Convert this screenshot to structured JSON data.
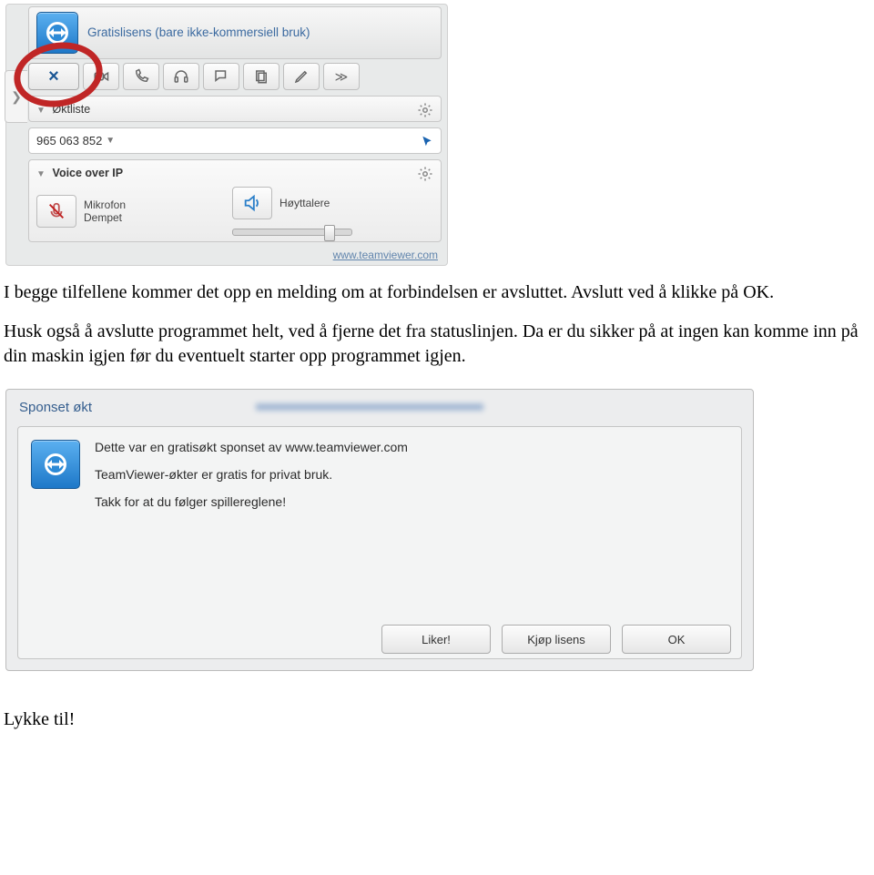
{
  "panel": {
    "header_text": "Gratislisens (bare ikke-kommersiell bruk)",
    "toolbar": {
      "close_label": "×",
      "icons": [
        "video-icon",
        "phone-icon",
        "headset-icon",
        "chat-icon",
        "windows-icon",
        "files-icon",
        "more-icon"
      ]
    },
    "sessions": {
      "title": "Øktliste",
      "id": "965 063 852"
    },
    "voip": {
      "title": "Voice over IP",
      "mic_label": "Mikrofon",
      "mic_status": "Dempet",
      "speaker_label": "Høyttalere"
    },
    "footer_link": "www.teamviewer.com",
    "expand_glyph": "❯"
  },
  "paragraphs": {
    "p1": "I begge tilfellene kommer det opp en melding om at forbindelsen er avsluttet. Avslutt ved å klikke på OK.",
    "p2": "Husk også å avslutte programmet helt, ved å fjerne det fra statuslinjen. Da er du sikker på at ingen kan komme inn på din maskin igjen før du eventuelt starter opp programmet igjen.",
    "closing": "Lykke til!"
  },
  "dialog": {
    "title": "Sponset økt",
    "line1": "Dette var en gratisøkt sponset av www.teamviewer.com",
    "line2": "TeamViewer-økter er gratis for privat bruk.",
    "line3": "Takk for at du følger spillereglene!",
    "buttons": {
      "like": "Liker!",
      "buy": "Kjøp lisens",
      "ok": "OK"
    }
  }
}
